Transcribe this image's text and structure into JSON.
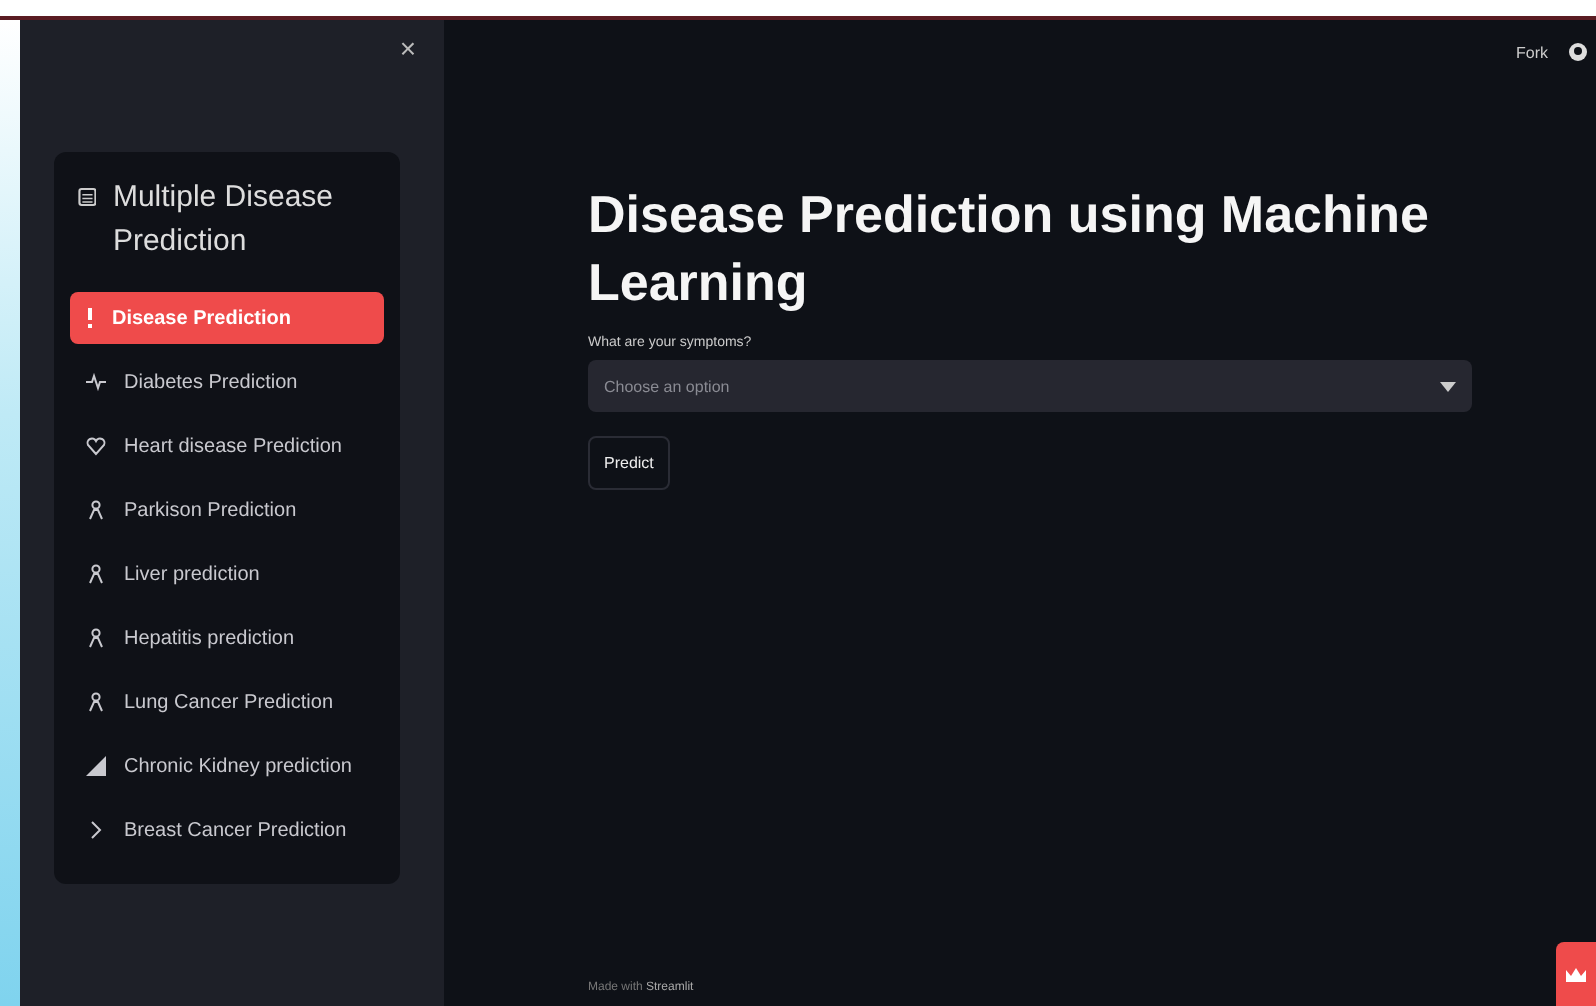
{
  "sidebar": {
    "close": "×",
    "menu_title": "Multiple Disease Prediction",
    "items": [
      {
        "label": "Disease Prediction",
        "selected": true
      },
      {
        "label": "Diabetes Prediction",
        "selected": false
      },
      {
        "label": "Heart disease Prediction",
        "selected": false
      },
      {
        "label": "Parkison Prediction",
        "selected": false
      },
      {
        "label": "Liver prediction",
        "selected": false
      },
      {
        "label": "Hepatitis prediction",
        "selected": false
      },
      {
        "label": "Lung Cancer Prediction",
        "selected": false
      },
      {
        "label": "Chronic Kidney prediction",
        "selected": false
      },
      {
        "label": "Breast Cancer Prediction",
        "selected": false
      }
    ]
  },
  "header": {
    "fork": "Fork"
  },
  "main": {
    "title": "Disease Prediction using Machine Learning",
    "select_label": "What are your symptoms?",
    "select_placeholder": "Choose an option",
    "button": "Predict"
  },
  "footer": {
    "prefix": "Made with ",
    "brand": "Streamlit"
  }
}
